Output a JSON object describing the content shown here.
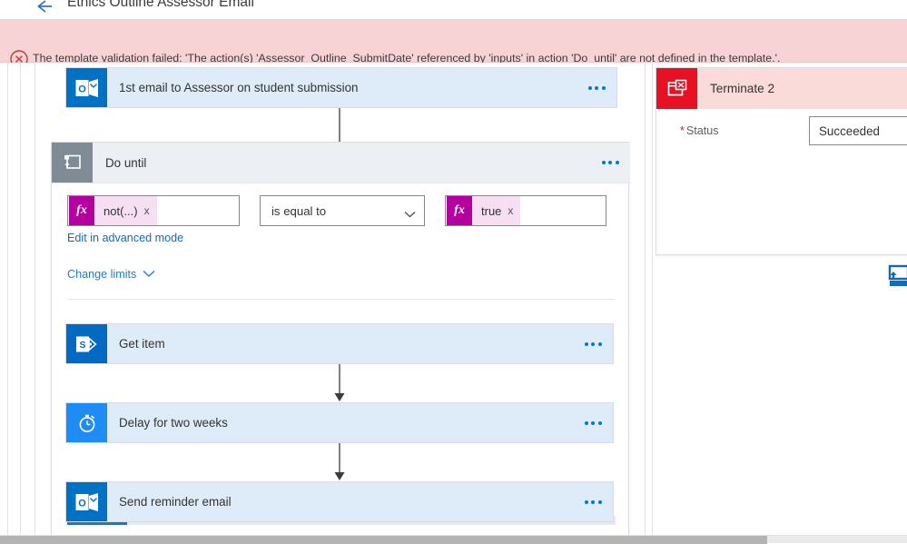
{
  "window": {
    "title": "Ethics Outline Assessor Email",
    "back_icon": "back-arrow-icon"
  },
  "error": {
    "icon": "error-circle-x-icon",
    "message": "The template validation failed: 'The action(s) 'Assessor_Outline_SubmitDate' referenced by 'inputs' in action 'Do_until' are not defined in the template.'.",
    "bg_color": "#f7d3d6",
    "icon_color": "#a4262c"
  },
  "flow": {
    "first_email": {
      "title": "1st email to Assessor on student submission",
      "icon": "outlook-icon",
      "icon_color": "#0072c6",
      "menu_label": "..."
    },
    "do_until": {
      "title": "Do until",
      "icon": "loop-scope-icon",
      "icon_color": "#7f8c96",
      "menu_label": "...",
      "condition": {
        "left_token": "not(...)",
        "left_token_fx": "fx",
        "operator": "is equal to",
        "right_token": "true",
        "right_token_fx": "fx",
        "remove_label": "x",
        "token_color": "#b4009e"
      },
      "advanced_link": "Edit in advanced mode",
      "change_limits_link": "Change limits",
      "actions": [
        {
          "title": "Get item",
          "icon": "sharepoint-icon",
          "icon_color": "#036ac4",
          "menu_label": "..."
        },
        {
          "title": "Delay for two weeks",
          "icon": "stopwatch-icon",
          "icon_color": "#1f8bf5",
          "menu_label": "..."
        },
        {
          "title": "Send reminder email",
          "icon": "outlook-icon",
          "icon_color": "#0072c6",
          "menu_label": "..."
        }
      ]
    }
  },
  "terminate_panel": {
    "title": "Terminate 2",
    "icon": "terminate-icon",
    "icon_color": "#e81123",
    "header_bg": "#fadbd9",
    "status_label": "Status",
    "required_mark": "*",
    "status_value": "Succeeded",
    "status_placeholder": "Status"
  },
  "side_icon": {
    "name": "loop-scope-icon-partial",
    "color": "#0f6cbd"
  },
  "scrollbars": {
    "horizontal_thumb_color": "#b4b4b4",
    "inner_thumb_color": "#0f7bd4"
  }
}
